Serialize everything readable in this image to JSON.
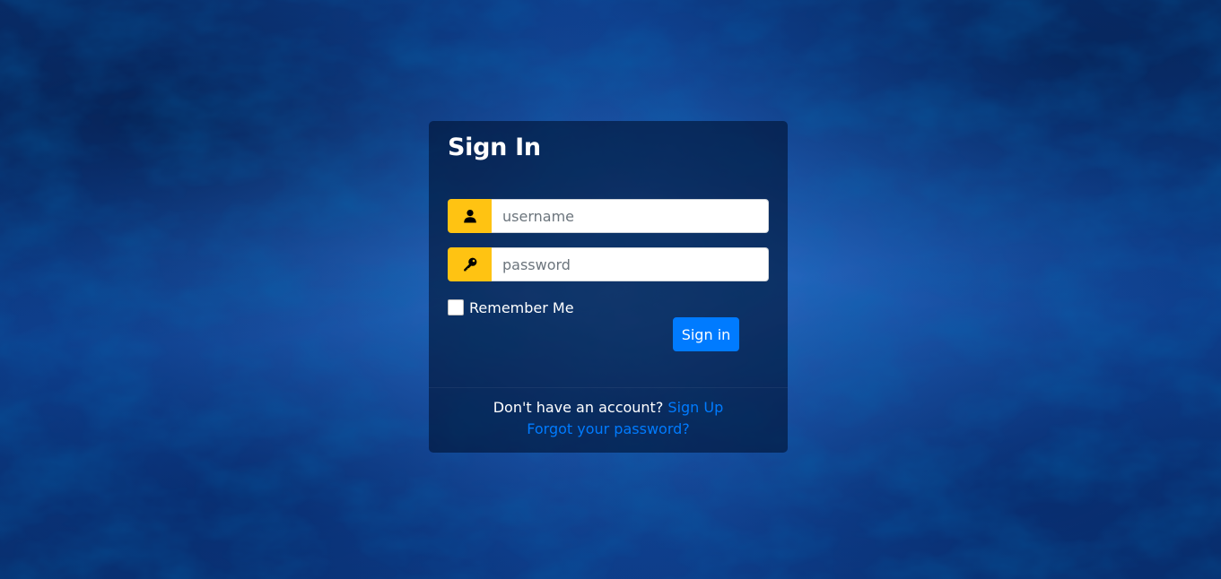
{
  "login": {
    "title": "Sign In",
    "username_placeholder": "username",
    "password_placeholder": "password",
    "remember_label": "Remember Me",
    "submit_label": "Sign in",
    "signup_prompt": "Don't have an account?",
    "signup_link": "Sign Up",
    "forgot_link": "Forgot your password?"
  },
  "icons": {
    "username": "user-icon",
    "password": "key-icon"
  },
  "colors": {
    "accent_addon": "#ffc312",
    "primary_button": "#007bff",
    "link": "#007bff",
    "card_bg": "rgba(0,18,50,0.62)"
  }
}
